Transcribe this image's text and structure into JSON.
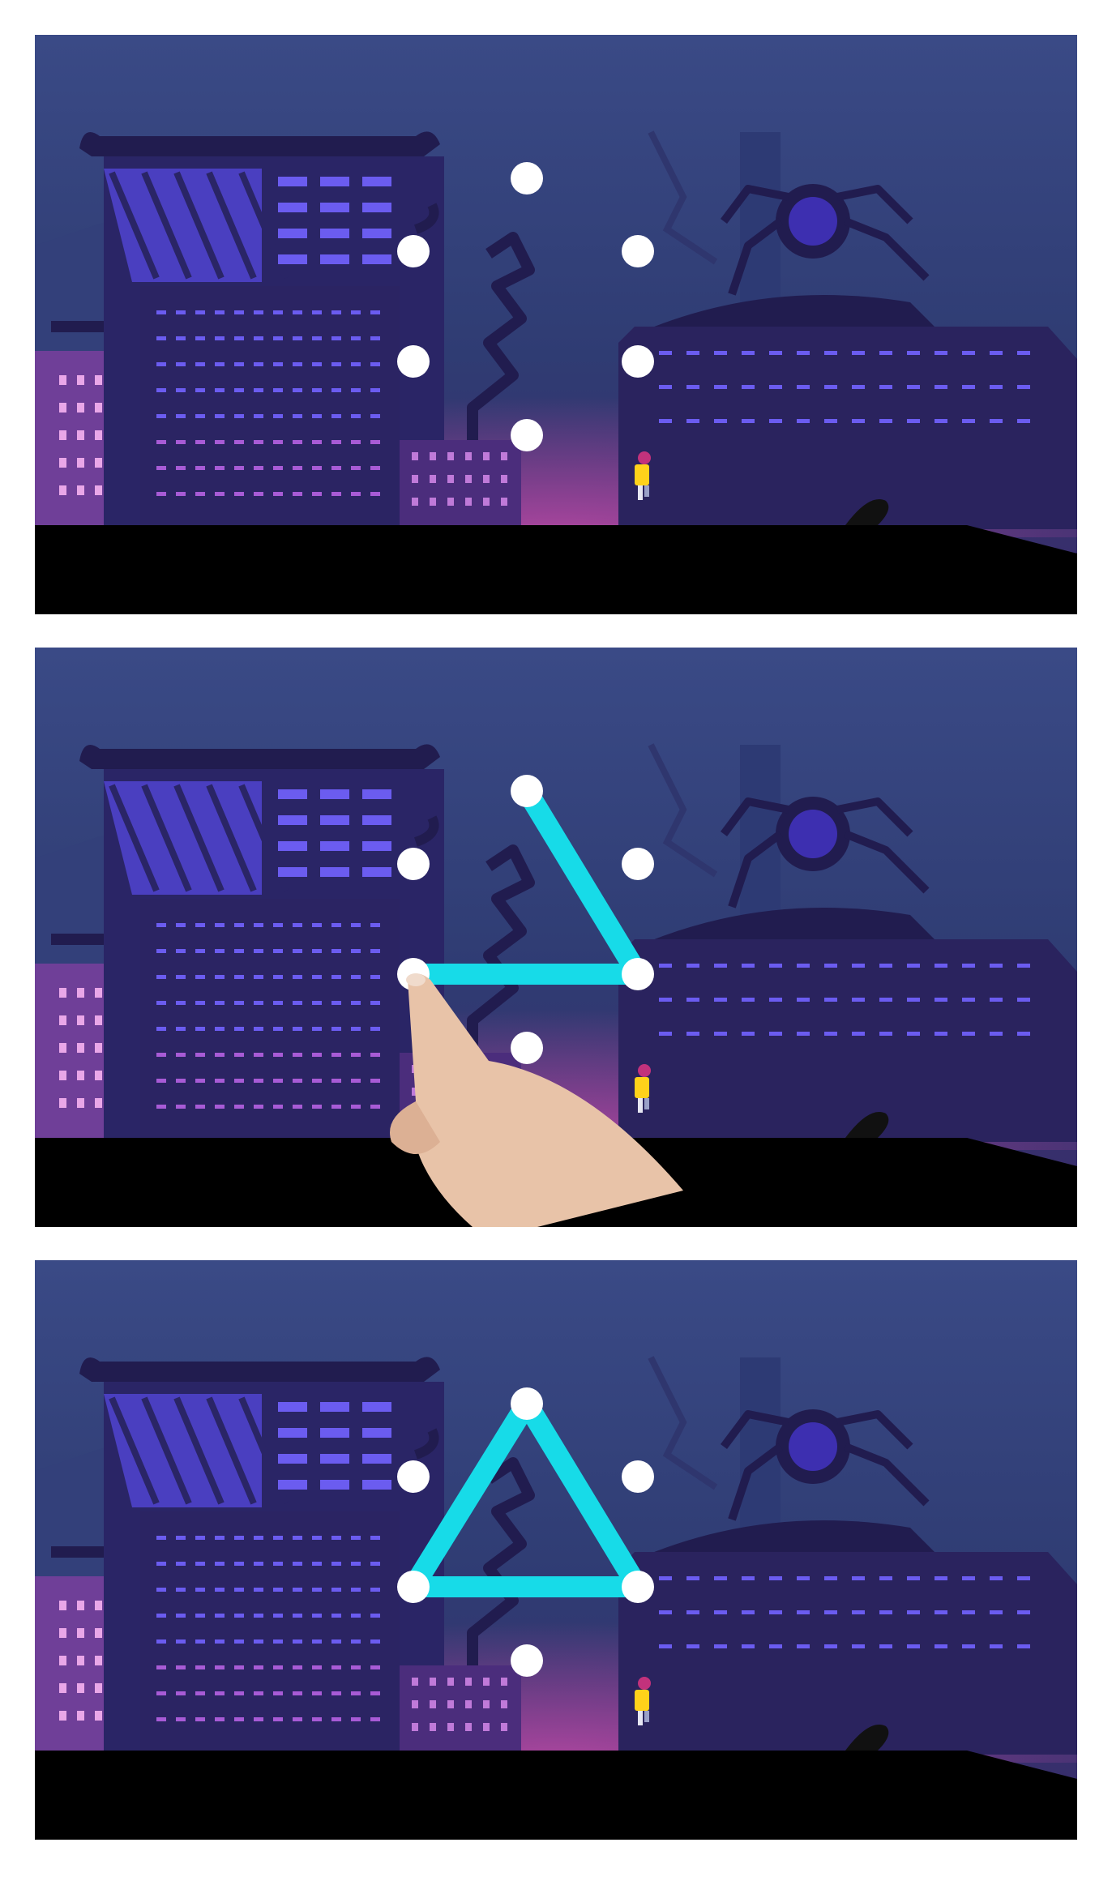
{
  "tutorial": {
    "steps": [
      {
        "step": 1,
        "stroke_progress": 0.0
      },
      {
        "step": 2,
        "stroke_progress": 0.67
      },
      {
        "step": 3,
        "stroke_progress": 1.0
      }
    ],
    "dot_count": 6,
    "gesture_shape": "triangle",
    "hand_icon": "pointing-hand-icon"
  },
  "colors": {
    "sky_top": "#3a4a86",
    "sky_bottom": "#2f3c73",
    "building": "#2a2566",
    "building_dark": "#211c4f",
    "window": "#6b5cf0",
    "glow": "#c24aa8",
    "ground": "#000000",
    "gesture_line": "#17dbe8",
    "dot": "#ffffff",
    "runner": "#ffd21a"
  }
}
